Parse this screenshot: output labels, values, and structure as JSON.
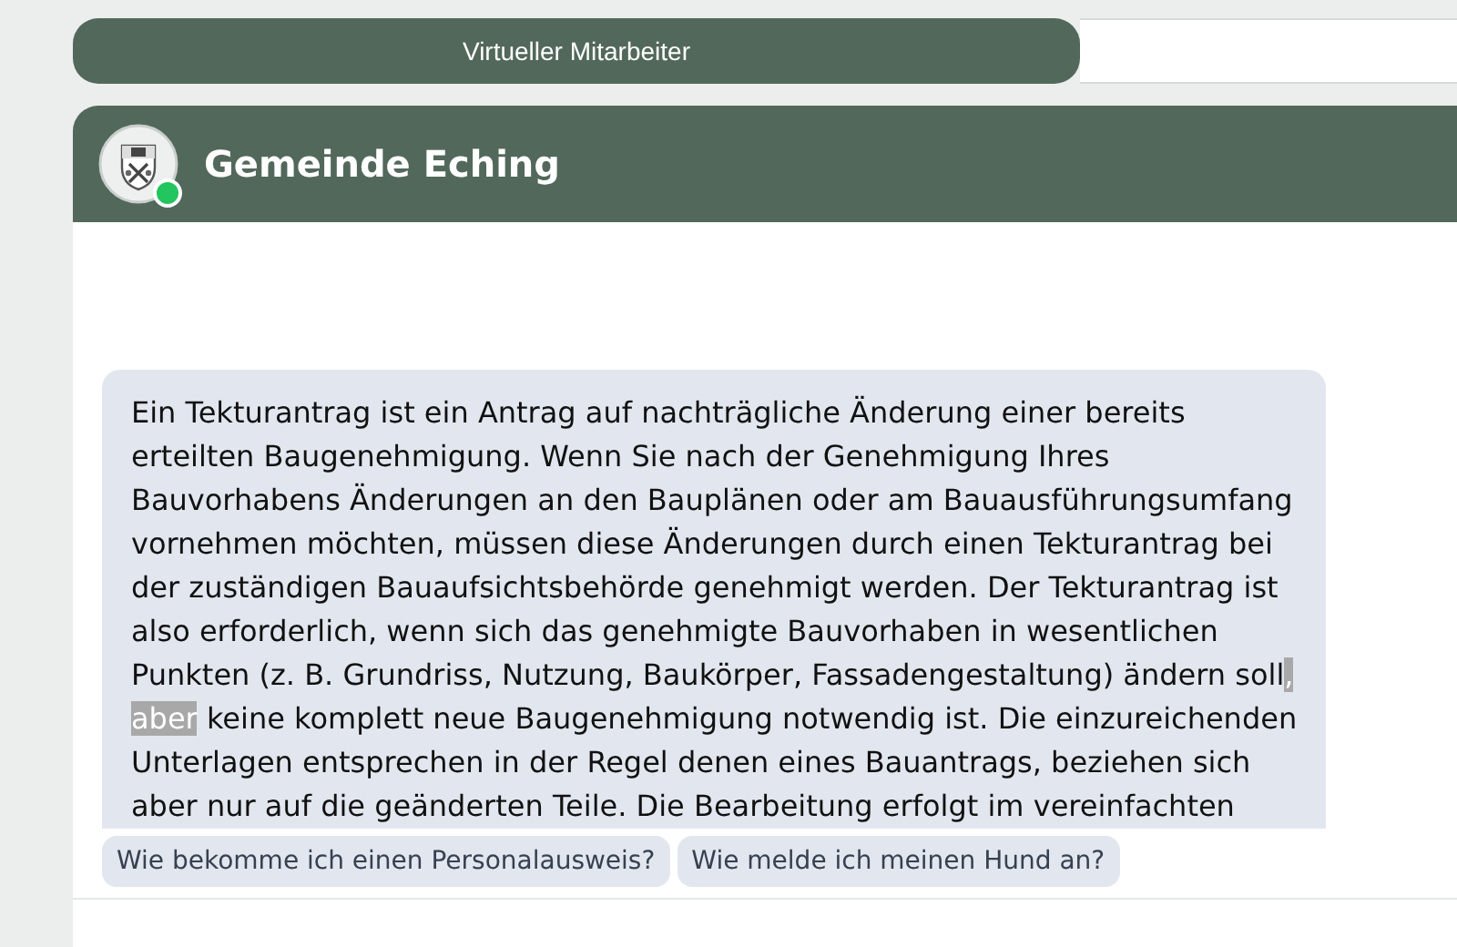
{
  "top_bar": {
    "title": "Virtueller Mitarbeiter"
  },
  "chat": {
    "title": "Gemeinde Eching",
    "online": true,
    "message": {
      "text_before": "Ein Tekturantrag ist ein Antrag auf nachträgliche Änderung einer bereits erteilten Baugenehmigung. Wenn Sie nach der Genehmigung Ihres Bauvorhabens Änderungen an den Bauplänen oder am Bauausführungsumfang vornehmen möchten, müssen diese Änderungen durch einen Tekturantrag bei der zuständigen Bauaufsichtsbehörde genehmigt werden. Der Tekturantrag ist also erforderlich, wenn sich das genehmigte Bauvorhaben in wesentlichen Punkten (z. B. Grundriss, Nutzung, Baukörper, Fassadengestaltung) ändern soll",
      "selection": ", aber",
      "text_after": " keine komplett neue Baugenehmigung notwendig ist. Die einzureichenden Unterlagen entsprechen in der Regel denen eines Bauantrags, beziehen sich aber nur auf die geänderten Teile. Die Bearbeitung erfolgt im vereinfachten"
    },
    "suggestions": [
      "Wie bekomme ich einen Personalausweis?",
      "Wie melde ich meinen Hund an?"
    ]
  }
}
